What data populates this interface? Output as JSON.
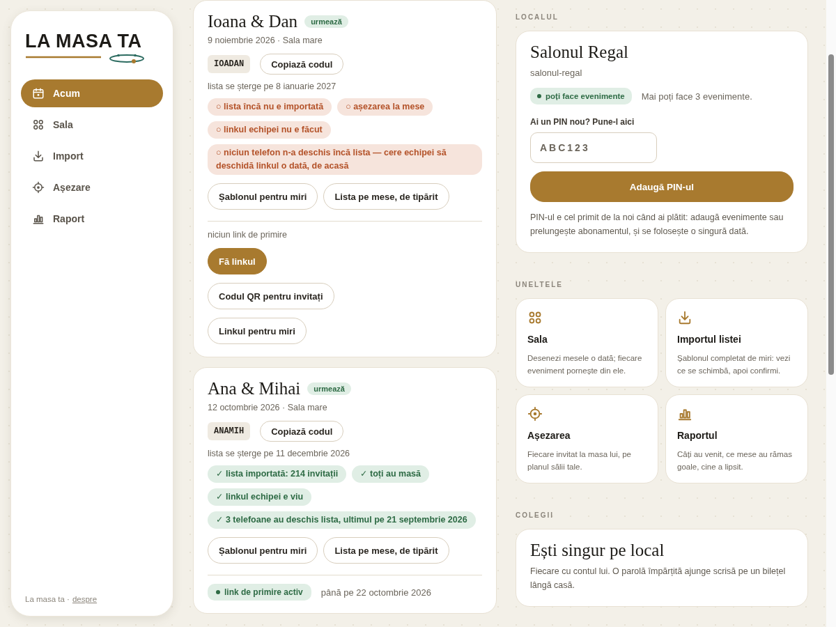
{
  "brand": {
    "name": "LA MASA TA"
  },
  "nav": [
    {
      "label": "Acum",
      "selected": true
    },
    {
      "label": "Sala",
      "selected": false
    },
    {
      "label": "Import",
      "selected": false
    },
    {
      "label": "Așezare",
      "selected": false
    },
    {
      "label": "Raport",
      "selected": false
    }
  ],
  "sidebar_footer": {
    "text": "La masa ta ·",
    "link": "despre"
  },
  "events": [
    {
      "title": "Ioana & Dan",
      "status": "urmează",
      "date_place": "9 noiembrie 2026 · Sala mare",
      "code": "IOADAN",
      "copy_button": "Copiază codul",
      "expiry": "lista se șterge pe 8 ianuarie 2027",
      "checks": [
        {
          "label": "○ lista încă nu e importată",
          "done": false
        },
        {
          "label": "○ așezarea la mese",
          "done": false
        },
        {
          "label": "○ linkul echipei nu e făcut",
          "done": false
        },
        {
          "label": "○ niciun telefon n-a deschis încă lista — cere echipei să deschidă linkul o dată, de acasă",
          "done": false
        }
      ],
      "buttons": [
        "Șablonul pentru miri",
        "Lista pe mese, de tipărit"
      ],
      "welcome_link": {
        "kind": "none",
        "text": "niciun link de primire",
        "buttons": [
          {
            "label": "Fă linkul",
            "primary": true
          },
          {
            "label": "Codul QR pentru invitați",
            "primary": false
          },
          {
            "label": "Linkul pentru miri",
            "primary": false
          }
        ]
      }
    },
    {
      "title": "Ana & Mihai",
      "status": "urmează",
      "date_place": "12 octombrie 2026 · Sala mare",
      "code": "ANAMIH",
      "copy_button": "Copiază codul",
      "expiry": "lista se șterge pe 11 decembrie 2026",
      "checks": [
        {
          "label": "✓ lista importată: 214 invitații",
          "done": true
        },
        {
          "label": "✓ toți au masă",
          "done": true
        },
        {
          "label": "✓ linkul echipei e viu",
          "done": true
        },
        {
          "label": "✓ 3 telefoane au deschis lista, ultimul pe 21 septembrie 2026",
          "done": true
        }
      ],
      "buttons": [
        "Șablonul pentru miri",
        "Lista pe mese, de tipărit"
      ],
      "welcome_link": {
        "kind": "active",
        "badge": "link de primire activ",
        "text": "până pe 22 octombrie 2026"
      }
    }
  ],
  "venue": {
    "section_label": "LOCALUL",
    "name": "Salonul Regal",
    "slug": "salonul-regal",
    "status": {
      "label": "poți face evenimente",
      "on": true
    },
    "note": "Mai poți face 3 evenimente.",
    "pin_label": "Ai un PIN nou? Pune-l aici",
    "pin_placeholder": "ABC123",
    "button": "Adaugă PIN-ul",
    "help": "PIN-ul e cel primit de la noi când ai plătit: adaugă evenimente sau prelungește abonamentul, și se folosește o singură dată."
  },
  "tools": {
    "section_label": "UNELTELE",
    "items": [
      {
        "title": "Sala",
        "text": "Desenezi mesele o dată; fiecare eveniment pornește din ele."
      },
      {
        "title": "Importul listei",
        "text": "Șablonul completat de miri: vezi ce se schimbă, apoi confirmi."
      },
      {
        "title": "Așezarea",
        "text": "Fiecare invitat la masa lui, pe planul sălii tale."
      },
      {
        "title": "Raportul",
        "text": "Câți au venit, ce mese au rămas goale, cine a lipsit."
      }
    ]
  },
  "colleagues": {
    "section_label": "COLEGII",
    "title": "Ești singur pe local",
    "text": "Fiecare cu contul lui. O parolă împărțită ajunge scrisă pe un bilețel lângă casă."
  }
}
